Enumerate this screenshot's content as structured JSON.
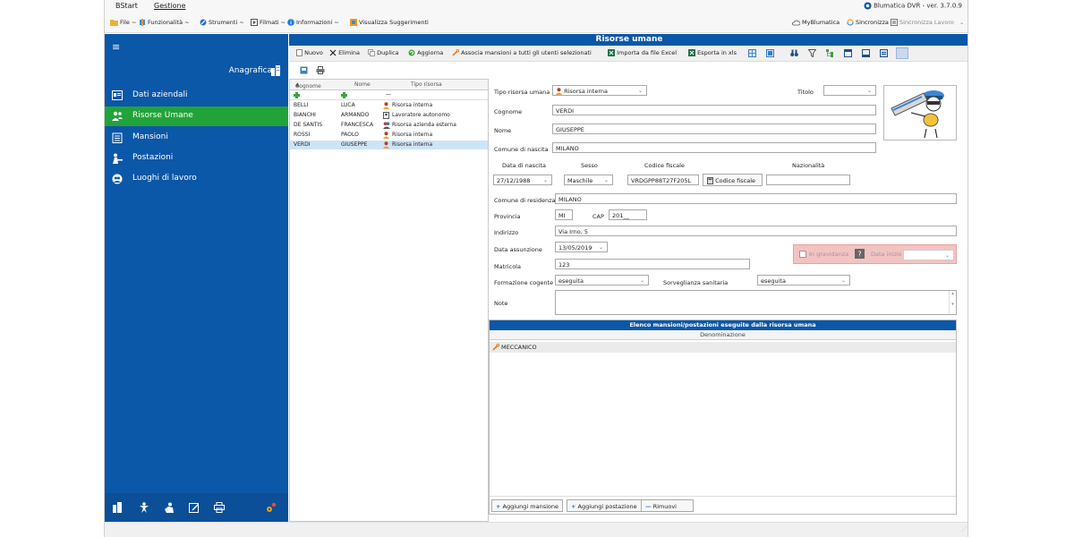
{
  "menu": {
    "tab1": "BStart",
    "tab2": "Gestione",
    "version": "Blumatica DVR - ver. 3.7.0.9"
  },
  "toolbar": {
    "file": "File ~",
    "funzionalita": "Funzionalità ~",
    "strumenti": "Strumenti ~",
    "filmati": "Filmati ~",
    "informazioni": "Informazioni ~",
    "suggerimenti": "Visualizza Suggerimenti",
    "myblumatica": "MyBlumatica",
    "sincronizza": "Sincronizza",
    "sinc_lavoro": "Sincronizza Lavoro"
  },
  "sidebar": {
    "section": "Anagrafica",
    "items": [
      {
        "label": "Dati aziendali"
      },
      {
        "label": "Risorse Umane"
      },
      {
        "label": "Mansioni"
      },
      {
        "label": "Postazioni"
      },
      {
        "label": "Luoghi di lavoro"
      }
    ]
  },
  "window": {
    "title": "Risorse umane"
  },
  "actions": {
    "nuovo": "Nuovo",
    "elimina": "Elimina",
    "duplica": "Duplica",
    "aggiorna": "Aggiorna",
    "associa": "Associa mansioni a tutti gli utenti selezionati",
    "importa": "Importa da file Excel",
    "esporta": "Esporta in xls"
  },
  "list": {
    "columns": [
      "Cognome",
      "Nome",
      "Tipo risorsa"
    ],
    "filter_dash": "—",
    "rows": [
      {
        "cognome": "BELLI",
        "nome": "LUCA",
        "tipo": "Risorsa interna"
      },
      {
        "cognome": "BIANCHI",
        "nome": "ARMANDO",
        "tipo": "Lavoratore autonomo"
      },
      {
        "cognome": "DE SANTIS",
        "nome": "FRANCESCA",
        "tipo": "Risorsa azienda esterna"
      },
      {
        "cognome": "ROSSI",
        "nome": "PAOLO",
        "tipo": "Risorsa interna"
      },
      {
        "cognome": "VERDI",
        "nome": "GIUSEPPE",
        "tipo": "Risorsa interna"
      }
    ]
  },
  "form": {
    "tipo_label": "Tipo risorsa umana",
    "tipo_value": "Risorsa interna",
    "titolo_label": "Titolo",
    "titolo_value": "",
    "cognome_label": "Cognome",
    "cognome_value": "VERDI",
    "nome_label": "Nome",
    "nome_value": "GIUSEPPE",
    "comune_nascita_label": "Comune di nascita",
    "comune_nascita_value": "MILANO",
    "data_nascita_label": "Data di nascita",
    "data_nascita_value": "27/12/1988",
    "sesso_label": "Sesso",
    "sesso_value": "Maschile",
    "cf_label": "Codice fiscale",
    "cf_value": "VRDGPP88T27F205L",
    "cf_button": "Codice fiscale",
    "nazionalita_label": "Nazionalità",
    "nazionalita_value": "",
    "comune_res_label": "Comune di residenza",
    "comune_res_value": "MILANO",
    "provincia_label": "Provincia",
    "provincia_value": "MI",
    "cap_label": "CAP",
    "cap_value": "201__",
    "indirizzo_label": "Indirizzo",
    "indirizzo_value": "Via Irno, 5",
    "data_ass_label": "Data assunzione",
    "data_ass_value": "13/05/2019",
    "gravidanza_label": "In gravidanza",
    "data_inizio_label": "Data inizio",
    "matricola_label": "Matricola",
    "matricola_value": "123",
    "formazione_label": "Formazione cogente",
    "formazione_value": "eseguita",
    "sorveglianza_label": "Sorveglianza sanitaria",
    "sorveglianza_value": "eseguita",
    "note_label": "Note",
    "note_value": ""
  },
  "mansioni": {
    "title": "Elenco mansioni/postazioni eseguite dalla risorsa umana",
    "column": "Denominazione",
    "rows": [
      {
        "label": "MECCANICO"
      }
    ],
    "add_mansione": "Aggiungi mansione",
    "add_postazione": "Aggiungi postazione",
    "rimuovi": "Rimuovi"
  },
  "colors": {
    "primary": "#0b57a8",
    "active": "#22a33a",
    "selected_row": "#cde4f7",
    "pregnancy_bg": "#f3c3c3"
  }
}
